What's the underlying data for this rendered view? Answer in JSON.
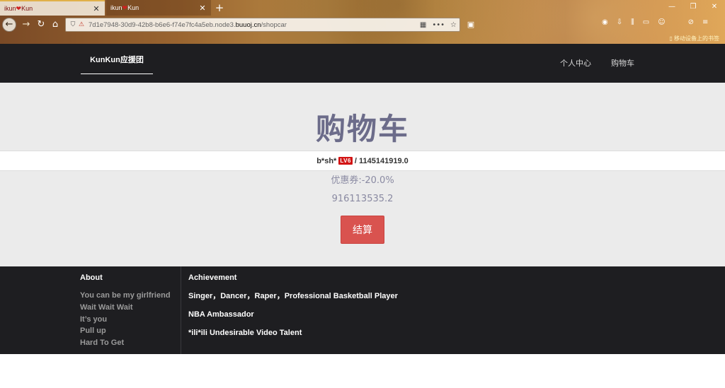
{
  "browser": {
    "tabs": [
      {
        "title_a": "ikun",
        "title_b": "Kun",
        "active": true
      },
      {
        "title_a": "ikun",
        "title_b": "Kun",
        "active": false
      }
    ],
    "new_tab": "+",
    "url_prefix": "7d1e7948-30d9-42b8-b6e6-f74e7fc4a5eb.node3.",
    "url_domain": "buuoj.cn",
    "url_path": "/shopcar",
    "bookmarks_label": "移动设备上的书签"
  },
  "nav": {
    "brand": "KunKun应援团",
    "links": [
      "个人中心",
      "购物车"
    ]
  },
  "cart": {
    "title": "购物车",
    "item_name": "b*sh*",
    "item_badge": "LV6",
    "item_sep": "/",
    "item_price": "1145141919.0",
    "coupon": "优惠券:-20.0%",
    "total": "916113535.2",
    "checkout_label": "结算"
  },
  "footer": {
    "about_title": "About",
    "about_items": [
      "You can be my girlfriend",
      "Wait Wait Wait",
      "It’s you",
      "Pull up",
      "Hard To Get"
    ],
    "achievement_title": "Achievement",
    "achievements": [
      "Singer，Dancer，Raper，Professional Basketball Player",
      "NBA Ambassador",
      "*ili*ili Undesirable Video Talent"
    ]
  },
  "colors": {
    "nav_bg": "#1e1e21",
    "main_bg": "#ebebeb",
    "title_color": "#6c6c8a",
    "checkout_bg": "#d9534f",
    "badge_bg": "#d21414"
  }
}
